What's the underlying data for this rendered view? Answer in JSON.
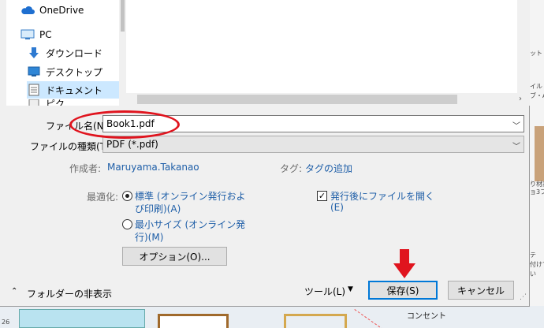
{
  "background": {
    "row_number": "26",
    "right_labels": [
      "ット",
      "イル",
      "ブ・A",
      "り材高",
      "ョ3フ",
      "テ",
      "付けて",
      "い"
    ],
    "bottom_text": "コンセント"
  },
  "nav": {
    "items": [
      {
        "label": "OneDrive",
        "icon": "cloud-icon"
      },
      {
        "label": "PC",
        "icon": "computer-icon"
      },
      {
        "label": "ダウンロード",
        "icon": "download-arrow-icon"
      },
      {
        "label": "デスクトップ",
        "icon": "desktop-icon"
      },
      {
        "label": "ドキュメント",
        "icon": "document-icon"
      }
    ],
    "partial_item": "ピク"
  },
  "form": {
    "filename_label": "ファイル名(N):",
    "filename_value": "Book1.pdf",
    "filetype_label": "ファイルの種類(T):",
    "filetype_value": "PDF (*.pdf)",
    "author_label": "作成者:",
    "author_value": "Maruyama.Takanao",
    "tags_label": "タグ:",
    "tags_value": "タグの追加",
    "optimize_label": "最適化:",
    "opt_standard_line1": "標準 (オンライン発行およ",
    "opt_standard_line2": "び印刷)(A)",
    "opt_min_line1": "最小サイズ (オンライン発",
    "opt_min_line2": "行)(M)",
    "open_after_line1": "発行後にファイルを開く",
    "open_after_line2": "(E)",
    "options_button": "オプション(O)...",
    "hide_folders": "フォルダーの非表示",
    "tools": "ツール(L)",
    "save_button": "保存(S)",
    "cancel_button": "キャンセル"
  },
  "state": {
    "optimize_selected": "standard",
    "open_after_checked": true
  },
  "colors": {
    "accent": "#0078d7",
    "link": "#1f5fa8",
    "annotation": "#e0141e",
    "selection": "#cce8ff"
  }
}
